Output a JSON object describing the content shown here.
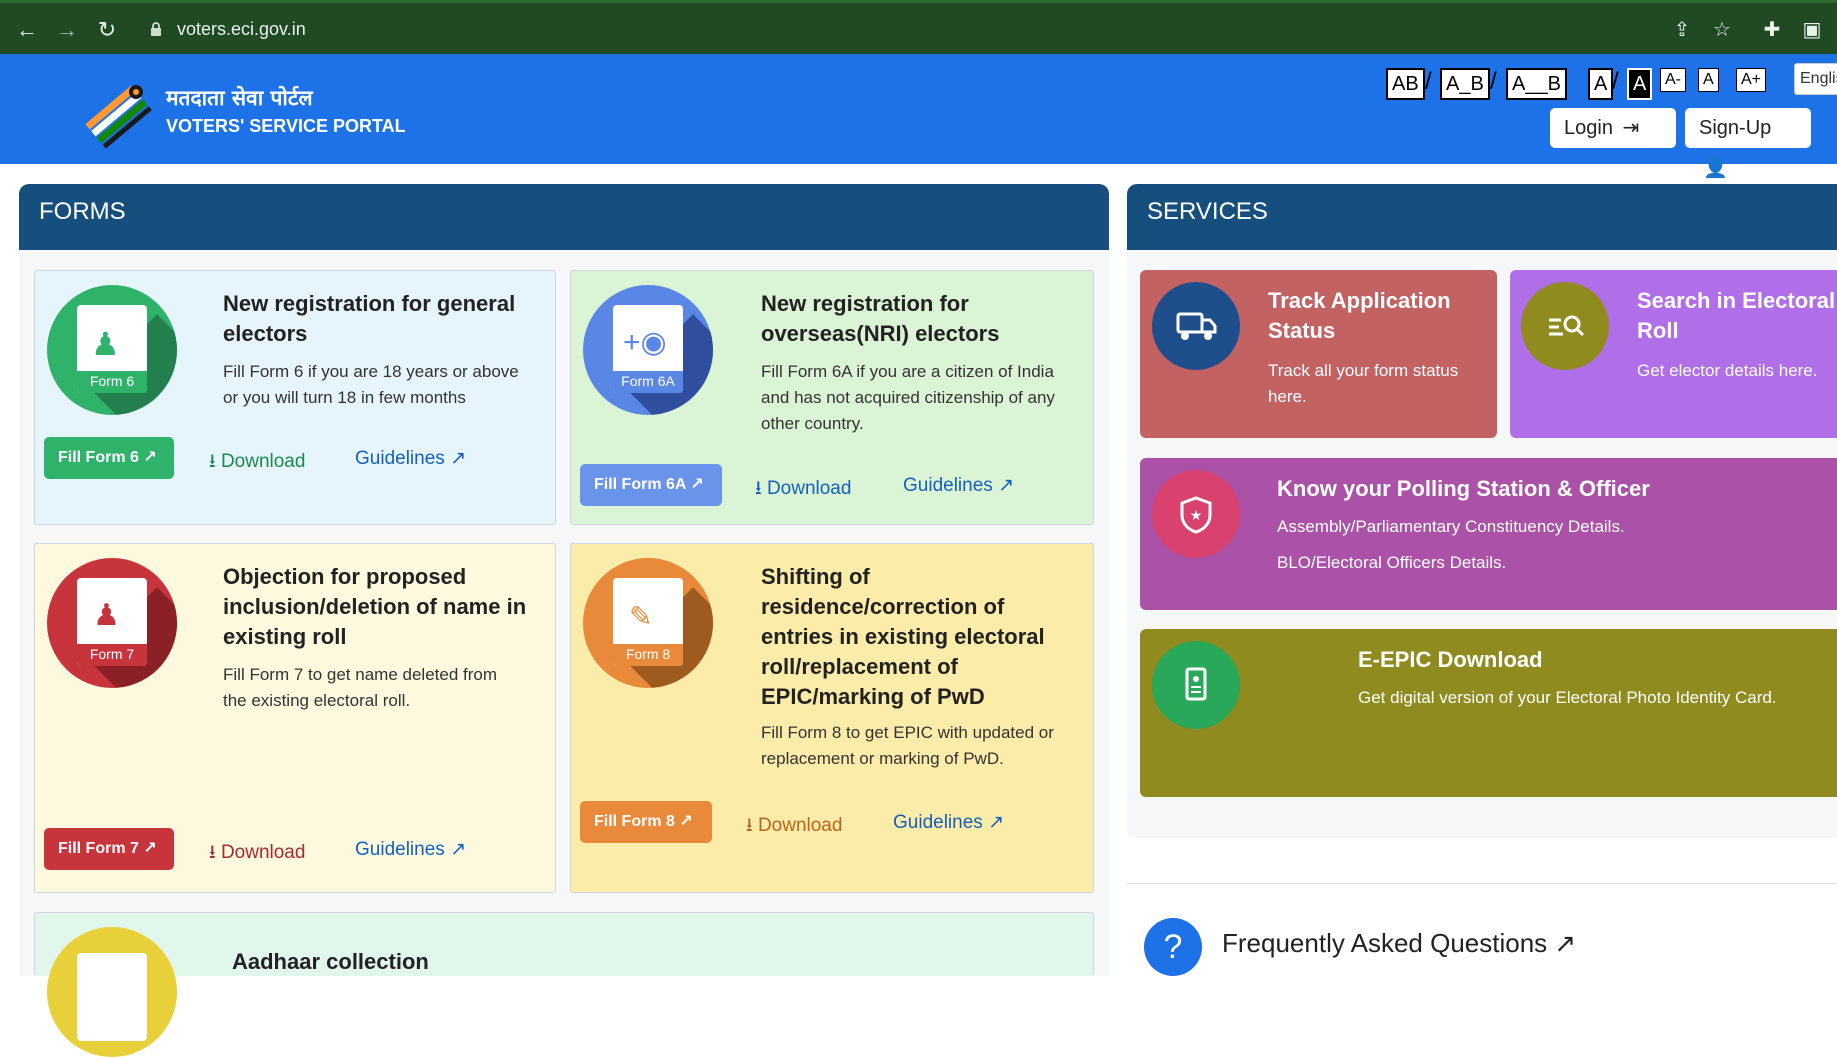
{
  "browser": {
    "url": "voters.eci.gov.in"
  },
  "header": {
    "title_hindi": "मतदाता सेवा पोर्टल",
    "title_english": "VOTERS' SERVICE PORTAL",
    "a11y": {
      "spacing_normal": "AB",
      "spacing_medium": "A_B",
      "spacing_large": "A__B",
      "contrast_light": "A",
      "contrast_dark": "A",
      "font_smaller": "A-",
      "font_normal": "A",
      "font_larger": "A+"
    },
    "language": "English",
    "login_label": "Login",
    "signup_label": "Sign-Up"
  },
  "forms": {
    "heading": "FORMS",
    "cards": [
      {
        "form_label": "Form 6",
        "title_line1": "New registration for general",
        "title_line2": "electors",
        "desc_line1": "Fill Form 6 if you are 18 years or above",
        "desc_line2": "or you will turn 18 in few months",
        "fill_label": "Fill Form 6",
        "download_label": "Download",
        "guidelines_label": "Guidelines"
      },
      {
        "form_label": "Form 6A",
        "title_line1": "New registration for",
        "title_line2": "overseas(NRI) electors",
        "desc_line1": "Fill Form 6A if you are a citizen of India",
        "desc_line2": "and has not acquired citizenship of any",
        "desc_line3": "other country.",
        "fill_label": "Fill Form 6A",
        "download_label": "Download",
        "guidelines_label": "Guidelines"
      },
      {
        "form_label": "Form 7",
        "title_line1": "Objection for proposed",
        "title_line2": "inclusion/deletion of name in",
        "title_line3": "existing roll",
        "desc_line1": "Fill Form 7 to get name deleted from",
        "desc_line2": "the existing electoral roll.",
        "fill_label": "Fill Form 7",
        "download_label": "Download",
        "guidelines_label": "Guidelines"
      },
      {
        "form_label": "Form 8",
        "title_line1": "Shifting of",
        "title_line2": "residence/correction of",
        "title_line3": "entries in existing electoral",
        "title_line4": "roll/replacement of",
        "title_line5": "EPIC/marking of PwD",
        "desc_line1": "Fill Form 8 to get EPIC with updated or",
        "desc_line2": "replacement or marking of PwD.",
        "fill_label": "Fill Form 8",
        "download_label": "Download",
        "guidelines_label": "Guidelines"
      },
      {
        "title_line1": "Aadhaar collection"
      }
    ]
  },
  "services": {
    "heading": "SERVICES",
    "track": {
      "title_line1": "Track Application",
      "title_line2": "Status",
      "desc_line1": "Track all your form status",
      "desc_line2": "here."
    },
    "search": {
      "title_line1": "Search in Electoral",
      "title_line2": "Roll",
      "desc_line1": "Get elector details here."
    },
    "polling": {
      "title": "Know your Polling Station & Officer",
      "desc_line1": "Assembly/Parliamentary Constituency Details.",
      "desc_line2": "BLO/Electoral Officers Details."
    },
    "epic": {
      "title": "E-EPIC Download",
      "desc": "Get digital version of your Electoral Photo Identity Card."
    }
  },
  "faq": {
    "title": "Frequently Asked Questions",
    "icon_glyph": "?"
  },
  "colors": {
    "browser_bar": "#1f4a24",
    "header_blue": "#1c72e6",
    "panel_head": "#164f7e",
    "form6_green": "#2fb36a",
    "form6a_blue": "#5a86e6",
    "form7_red": "#c8343c",
    "form8_orange": "#e88a3a",
    "track_card": "#c36262",
    "search_card": "#b06ee8",
    "polling_card": "#ab52a8",
    "epic_card": "#8f8b1e"
  }
}
